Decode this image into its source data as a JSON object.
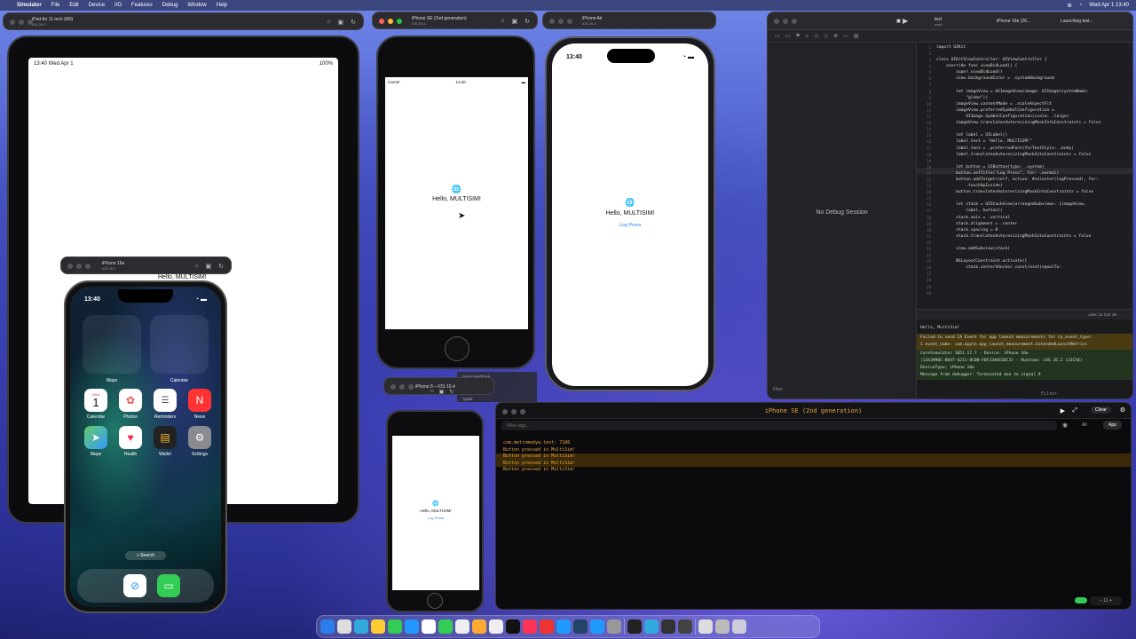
{
  "menubar": {
    "app": "Simulator",
    "items": [
      "File",
      "Edit",
      "Device",
      "I/O",
      "Features",
      "Debug",
      "Window",
      "Help"
    ],
    "clock": "Wed Apr 1  13:40"
  },
  "ipad_air": {
    "title": "iPad Air 11-inch (M3)",
    "os": "iOS 26.2",
    "time": "13:40  Wed Apr 1",
    "battery": "100%"
  },
  "iphone_se": {
    "title": "iPhone SE (2nd generation)",
    "os": "iOS 16.4",
    "carrier": "Carrier",
    "time": "13:40",
    "hello": "Hello, MULTISIM!"
  },
  "iphone_air": {
    "title": "iPhone Air",
    "os": "iOS 26.2",
    "time": "13:40",
    "hello": "Hello, MULTISIM!",
    "log_button": "Log Press"
  },
  "iphone_16e": {
    "title": "iPhone 16e",
    "os": "iOS 26.2",
    "time": "13:40",
    "widgets": [
      "Maps",
      "Calendar"
    ],
    "apps_row1": [
      "Calendar",
      "Photos",
      "Reminders",
      "News"
    ],
    "apps_row2": [
      "Maps",
      "Health",
      "Wallet",
      "Settings"
    ],
    "calendar_day": "Wed",
    "calendar_date": "1",
    "search": "Search",
    "behind_text": "Hello, MULTISIM!"
  },
  "iphone_8": {
    "title": "iPhone 8 – iOS 16.4",
    "hello": "Hello, MULTISIM!",
    "log_button": "Log Press"
  },
  "xcode": {
    "project": "test",
    "branch": "main",
    "scheme": "iPhone 16e (26...",
    "status": "Launching test...",
    "no_session": "No Debug Session",
    "filter": "Filter",
    "cursor": "Line: 14  Col: 26",
    "line_numbers": "1\n2\n3\n4\n5\n6\n7\n8\n9\n10\n11\n12\n13\n14\n15\n16\n17\n18\n19\n20\n21\n22\n23\n24\n25\n26\n27\n28\n29\n30\n31\n32\n33\n34\n35\n36\n37\n38\n39\n40",
    "code": "import UIKit\n\nclass UIKitViewController: UIViewController {\n    override func viewDidLoad() {\n        super.viewDidLoad()\n        view.backgroundColor = .systemBackground\n\n        let imageView = UIImageView(image: UIImage(systemName:\n            \"globe\"))\n        imageView.contentMode = .scaleAspectFit\n        imageView.preferredSymbolConfiguration =\n            UIImage.SymbolConfiguration(scale: .large)\n        imageView.translatesAutoresizingMaskIntoConstraints = false\n\n        let label = UILabel()\n        label.text = \"Hello, MULTISIM!\"\n        label.font = .preferredFont(forTextStyle: .body)\n        label.translatesAutoresizingMaskIntoConstraints = false\n\n        let button = UIButton(type: .system)\n        button.setTitle(\"Log Press\", for: .normal)\n        button.addTarget(self, action: #selector(logPressed), for:\n            .touchUpInside)\n        button.translatesAutoresizingMaskIntoConstraints = false\n\n        let stack = UIStackView(arrangedSubviews: [imageView,\n            label, button])\n        stack.axis = .vertical\n        stack.alignment = .center\n        stack.spacing = 8\n        stack.translatesAutoresizingMaskIntoConstraints = false\n\n        view.addSubview(stack)\n\n        NSLayoutConstraint.activate([\n            stack.centerXAnchor.constraint(equalTo:",
    "debug_lines": [
      "Hello, MultiSim!",
      "Failed to send CA Event for app launch measurements for ca_event_type:",
      "1 event_name: com.apple.app_launch_measurement.ExtendedLaunchMetrics",
      "CoreSimulator 1051.17.7 - Device: iPhone 16e",
      "(1343990C-B847-4211-8C0B-FDF23A6C68C3) - Runtime: iOS 26.2 (23C54) -",
      "DeviceType: iPhone 16e",
      "Message from debugger: Terminated due to signal 9"
    ]
  },
  "console": {
    "title": "iPhone SE (2nd generation)",
    "clear": "Clear",
    "filter_placeholder": "Filter logs...",
    "tabs": [
      "All",
      "App"
    ],
    "logs": [
      "com.metromedya.test: 7186",
      "Button pressed in MultiSim!",
      "Button pressed in MultiSim!",
      "Button pressed in MultiSim!",
      "Button pressed in MultiSim!"
    ],
    "zoom": "11"
  },
  "background_fragment": "Send Feedback",
  "background_fragment2": "Apple"
}
